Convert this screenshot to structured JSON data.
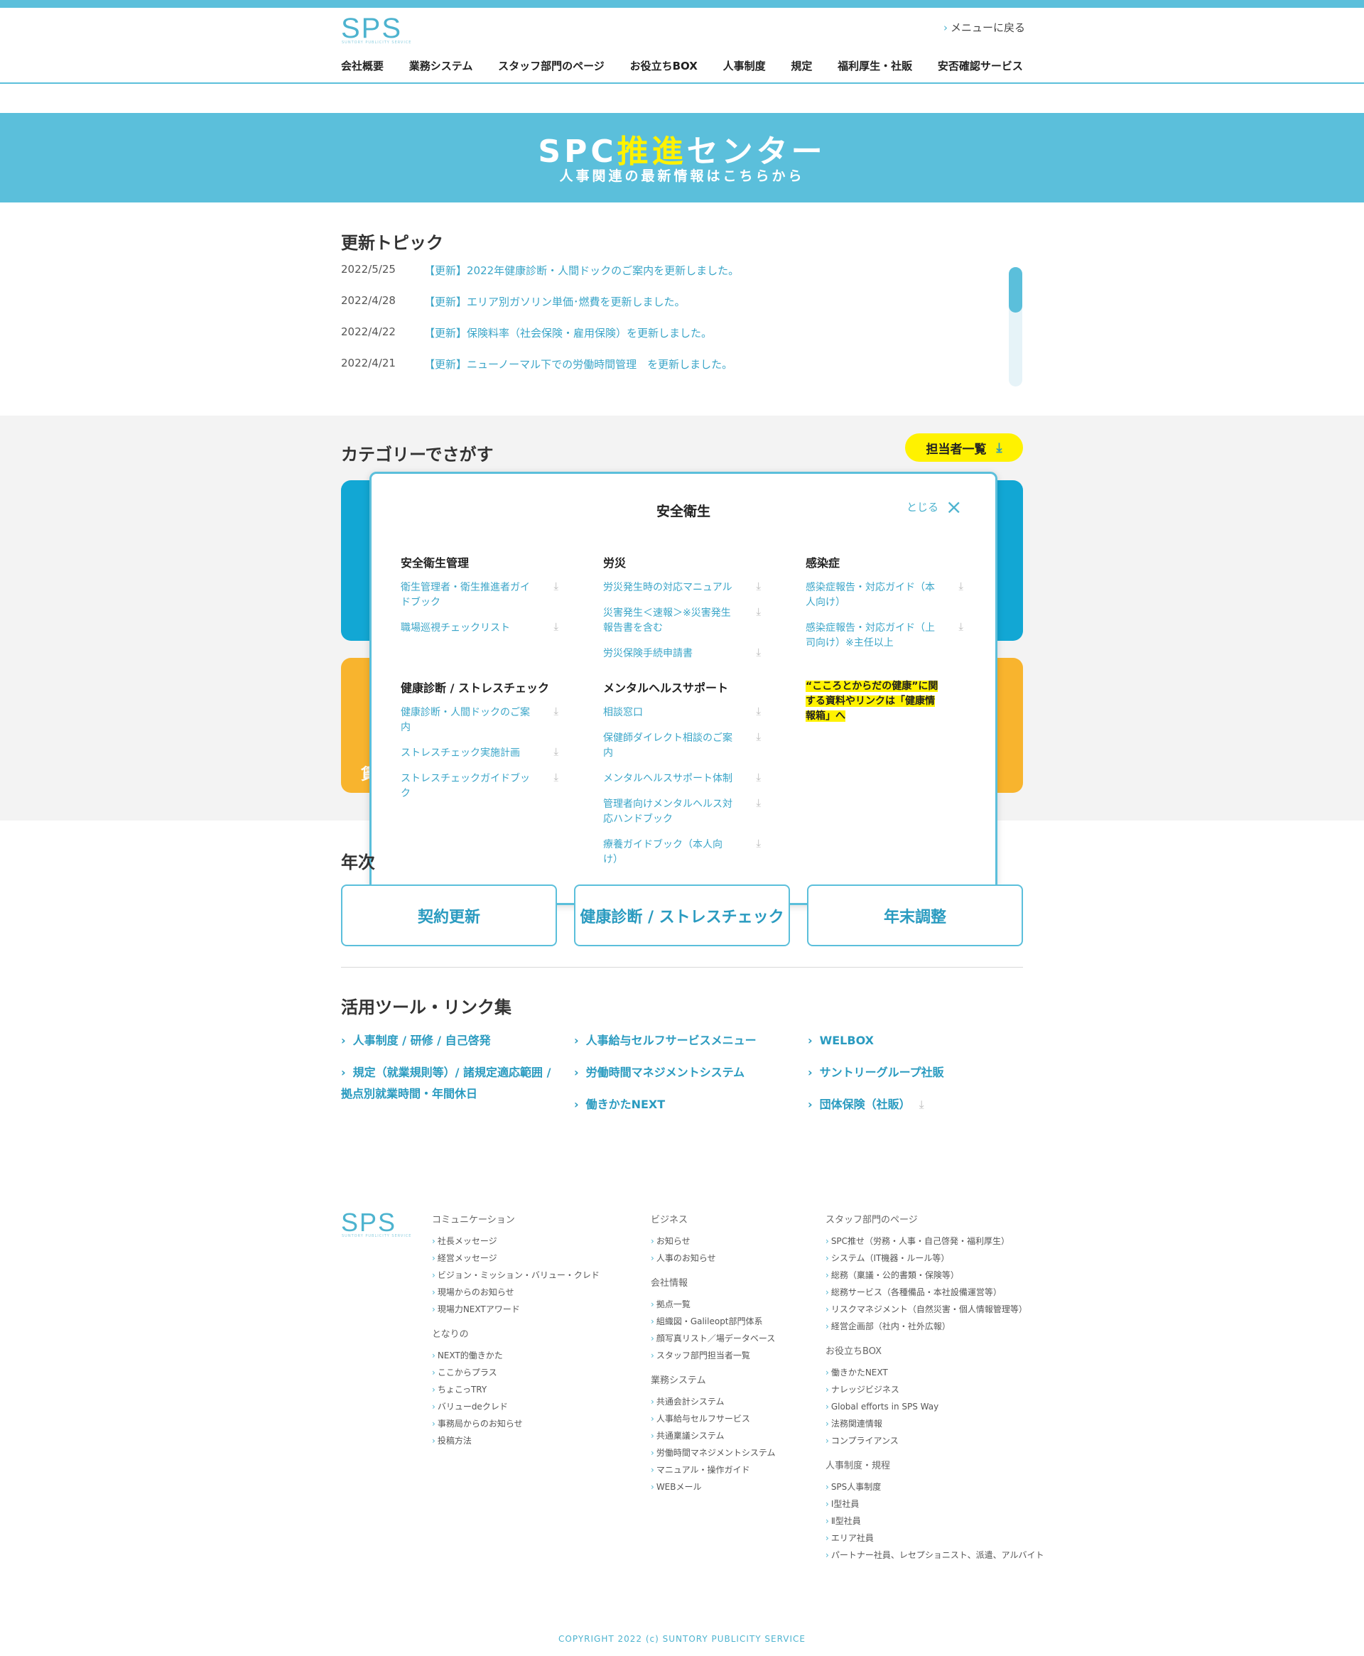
{
  "header": {
    "logo": "SPS",
    "logo_sub": "SUNTORY PUBLICITY SERVICE",
    "back_link": "メニューに戻る",
    "nav": [
      "会社概要",
      "業務システム",
      "スタッフ部門のページ",
      "お役立ちBOX",
      "人事制度",
      "規定",
      "福利厚生・社販",
      "安否確認サービス"
    ]
  },
  "hero": {
    "title_pre": "SPC",
    "title_hl": "推進",
    "title_post": "センター",
    "subtitle": "人事関連の最新情報はこちらから"
  },
  "topics": {
    "title": "更新トピック",
    "items": [
      {
        "date": "2022/5/25",
        "text": "【更新】2022年健康診断・人間ドックのご案内を更新しました。"
      },
      {
        "date": "2022/4/28",
        "text": "【更新】エリア別ガソリン単価･燃費を更新しました。"
      },
      {
        "date": "2022/4/22",
        "text": "【更新】保険料率（社会保険・雇用保険）を更新しました。"
      },
      {
        "date": "2022/4/21",
        "text": "【更新】ニューノーマル下での労働時間管理　を更新しました。"
      }
    ]
  },
  "category": {
    "title": "カテゴリーでさがす",
    "person_button": "担当者一覧",
    "behind_label": "賃"
  },
  "modal": {
    "title": "安全衛生",
    "close_label": "とじる",
    "groups": [
      {
        "title": "安全衛生管理",
        "items": [
          "衛生管理者・衛生推進者ガイドブック",
          "職場巡視チェックリスト"
        ]
      },
      {
        "title": "労災",
        "items": [
          "労災発生時の対応マニュアル",
          "災害発生＜速報＞※災害発生報告書を含む",
          "労災保険手続申請書"
        ]
      },
      {
        "title": "感染症",
        "items": [
          "感染症報告・対応ガイド（本人向け）",
          "感染症報告・対応ガイド（上司向け）※主任以上"
        ]
      },
      {
        "title": "健康診断 / ストレスチェック",
        "items": [
          "健康診断・人間ドックのご案内",
          "ストレスチェック実施計画",
          "ストレスチェックガイドブック"
        ]
      },
      {
        "title": "メンタルヘルスサポート",
        "items": [
          "相談窓口",
          "保健師ダイレクト相談のご案内",
          "メンタルヘルスサポート体制",
          "管理者向けメンタルヘルス対応ハンドブック",
          "療養ガイドブック（本人向け）"
        ]
      }
    ],
    "note": "“こころとからだの健康”に関する資料やリンクは「健康情報箱」へ"
  },
  "yearly": {
    "title_partial": "年次",
    "buttons": [
      "契約更新",
      "健康診断 / ストレスチェック",
      "年末調整"
    ]
  },
  "tools": {
    "title": "活用ツール・リンク集",
    "items": [
      "人事制度 / 研修 / 自己啓発",
      "規定（就業規則等）/ 諸規定適応範囲 / 拠点別就業時間・年間休日",
      "人事給与セルフサービスメニュー",
      "労働時間マネジメントシステム",
      "働きかたNEXT",
      "WELBOX",
      "サントリーグループ社販",
      "団体保険（社販）"
    ]
  },
  "footer": {
    "logo": "SPS",
    "logo_sub": "SUNTORY PUBLICITY SERVICE",
    "col1": [
      {
        "head": "コミュニケーション",
        "items": [
          "社長メッセージ",
          "経営メッセージ",
          "ビジョン・ミッション・バリュー・クレド",
          "現場からのお知らせ",
          "現場力NEXTアワード"
        ]
      },
      {
        "head": "となりの",
        "items": [
          "NEXT的働きかた",
          "ここからプラス",
          "ちょこっTRY",
          "バリューdeクレド",
          "事務局からのお知らせ",
          "投稿方法"
        ]
      }
    ],
    "col2": [
      {
        "head": "ビジネス",
        "items": [
          "お知らせ",
          "人事のお知らせ"
        ]
      },
      {
        "head": "会社情報",
        "items": [
          "拠点一覧",
          "組織図・Galileopt部門体系",
          "顔写真リスト／場データベース",
          "スタッフ部門担当者一覧"
        ]
      },
      {
        "head": "業務システム",
        "items": [
          "共通会計システム",
          "人事給与セルフサービス",
          "共通稟議システム",
          "労働時間マネジメントシステム",
          "マニュアル・操作ガイド",
          "WEBメール"
        ]
      }
    ],
    "col3": [
      {
        "head": "スタッフ部門のページ",
        "items": [
          "SPC推せ（労務・人事・自己啓発・福利厚生）",
          "システム（IT機器・ルール等）",
          "総務（稟議・公的書類・保険等）",
          "総務サービス（各種備品・本社設備運営等）",
          "リスクマネジメント（自然災害・個人情報管理等）",
          "経営企画部（社内・社外広報）"
        ]
      },
      {
        "head": "お役立ちBOX",
        "items": [
          "働きかたNEXT",
          "ナレッジビジネス",
          "Global efforts in SPS Way",
          "法務関連情報",
          "コンプライアンス"
        ]
      },
      {
        "head": "人事制度・規程",
        "items": [
          "SPS人事制度",
          "Ⅰ型社員",
          "Ⅱ型社員",
          "エリア社員",
          "パートナー社員、レセプショニスト、派遣、アルバイト"
        ]
      }
    ],
    "copyright": "COPYRIGHT 2022 (c) SUNTORY PUBLICITY SERVICE"
  },
  "colors": {
    "brand": "#5bbfdb",
    "link": "#3aa5c8",
    "highlight": "#fff200",
    "orange": "#f8b42e",
    "blue": "#12a7d4"
  },
  "icons": {
    "download": "download-icon",
    "close": "close-icon",
    "chevron": "chevron-right-icon"
  }
}
